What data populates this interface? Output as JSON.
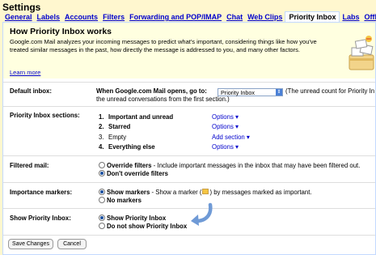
{
  "page_title": "Settings",
  "tabs": [
    {
      "label": "General"
    },
    {
      "label": "Labels"
    },
    {
      "label": "Accounts"
    },
    {
      "label": "Filters"
    },
    {
      "label": "Forwarding and POP/IMAP"
    },
    {
      "label": "Chat"
    },
    {
      "label": "Web Clips"
    },
    {
      "label": "Priority Inbox"
    },
    {
      "label": "Labs"
    },
    {
      "label": "Offline"
    }
  ],
  "intro": {
    "heading": "How Priority Inbox works",
    "text": "Google.com Mail analyzes your incoming messages to predict what's important, considering things like how you've treated similar messages in the past, how directly the message is addressed to you, and many other factors.",
    "learn_more": "Learn more"
  },
  "default_inbox": {
    "label": "Default inbox:",
    "prefix": "When Google.com Mail opens, go to:",
    "selected": "Priority Inbox",
    "note_line1": "(The unread count for Priority In",
    "note_line2": "the unread conversations from the first section.)"
  },
  "sections": {
    "label": "Priority Inbox sections:",
    "items": [
      {
        "num": "1.",
        "name": "Important and unread",
        "action": "Options ▾"
      },
      {
        "num": "2.",
        "name": "Starred",
        "action": "Options ▾"
      },
      {
        "num": "3.",
        "name": "Empty",
        "action": "Add section ▾"
      },
      {
        "num": "4.",
        "name": "Everything else",
        "action": "Options ▾"
      }
    ]
  },
  "filtered_mail": {
    "label": "Filtered mail:",
    "opt1": "Override filters",
    "opt1_desc": " - Include important messages in the inbox that may have been filtered out.",
    "opt2": "Don't override filters"
  },
  "importance_markers": {
    "label": "Importance markers:",
    "opt1": "Show markers",
    "opt1_desc_a": " - Show a marker (",
    "opt1_desc_b": ") by messages marked as important.",
    "opt2": "No markers"
  },
  "show_priority": {
    "label": "Show Priority Inbox:",
    "opt1": "Show Priority Inbox",
    "opt2": "Do not show Priority Inbox"
  },
  "buttons": {
    "save": "Save Changes",
    "cancel": "Cancel"
  }
}
